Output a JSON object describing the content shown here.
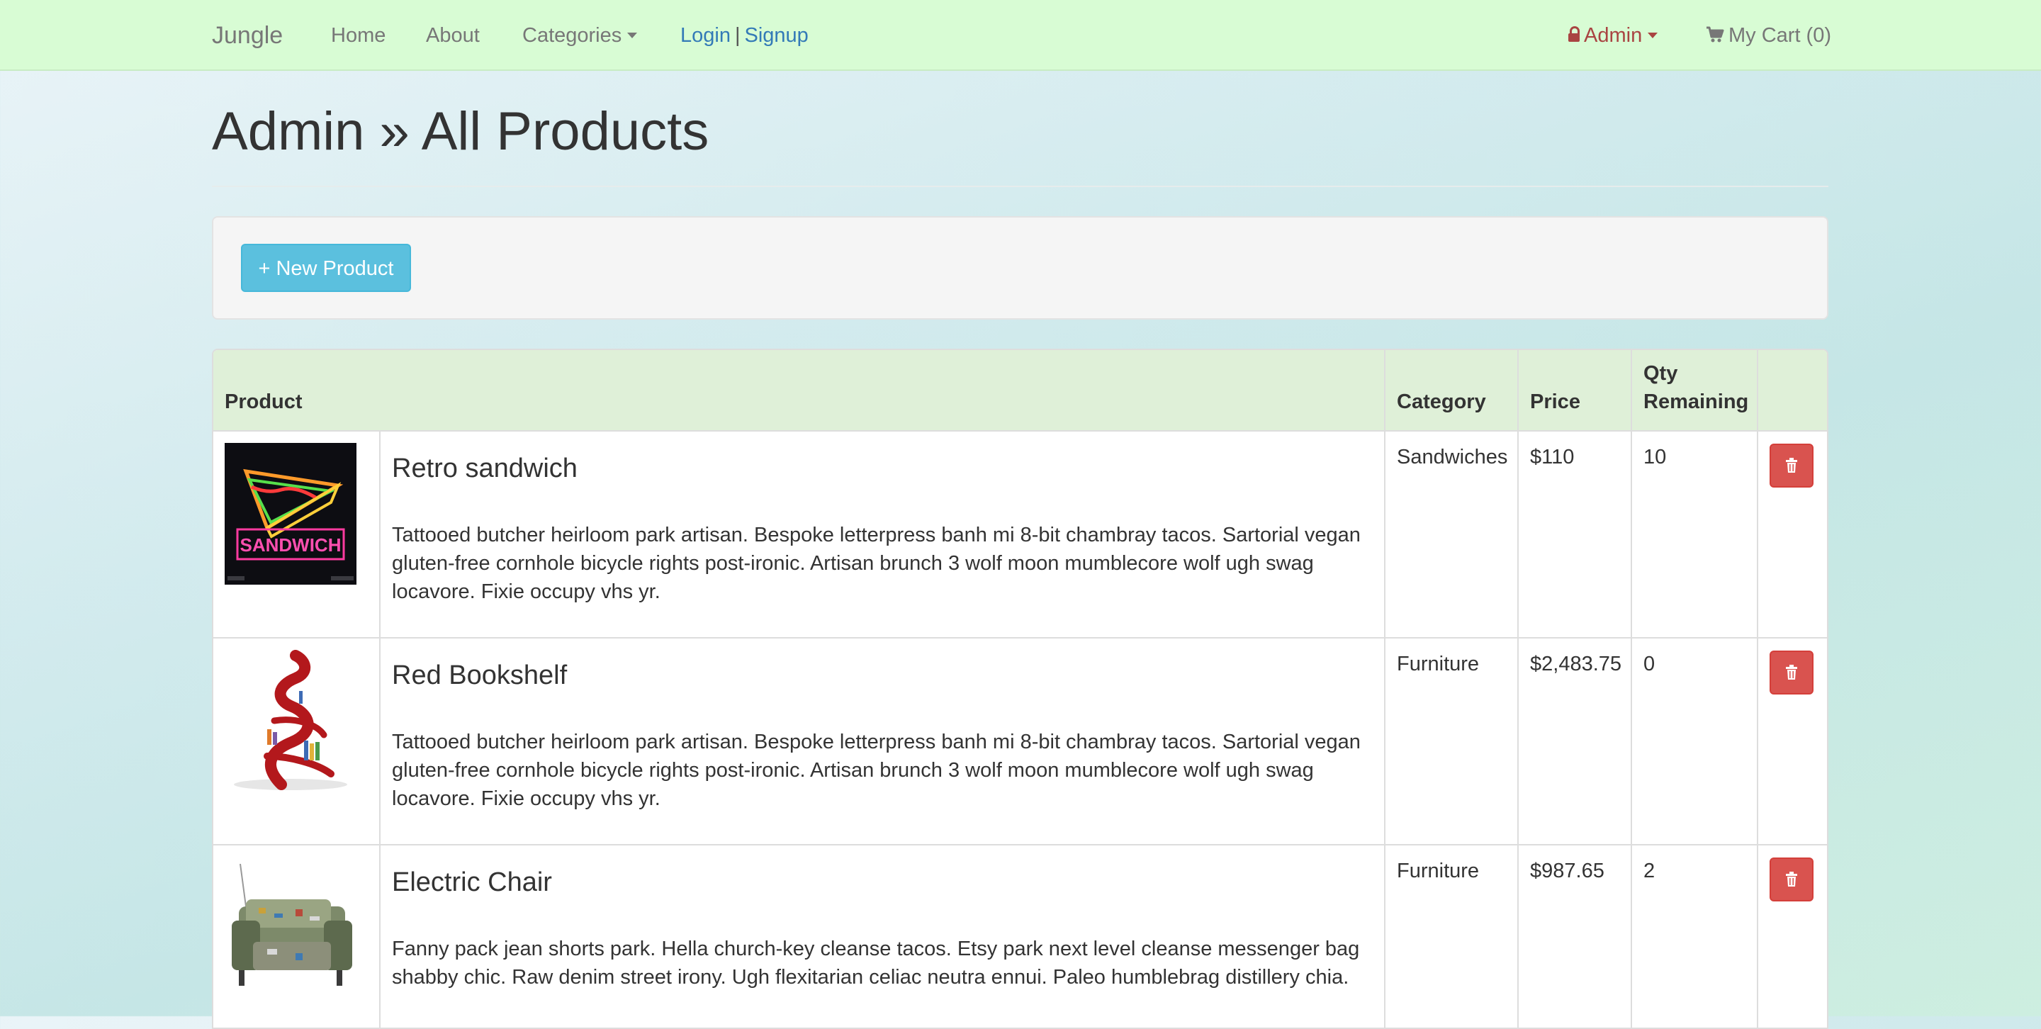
{
  "nav": {
    "brand": "Jungle",
    "home": "Home",
    "about": "About",
    "categories": "Categories",
    "login": "Login",
    "separator": "|",
    "signup": "Signup",
    "admin": "Admin",
    "cart": "My Cart (0)"
  },
  "page": {
    "title": "Admin » All Products",
    "new_product_label": "+ New Product"
  },
  "table": {
    "headers": {
      "product": "Product",
      "category": "Category",
      "price": "Price",
      "qty": "Qty Remaining"
    },
    "rows": [
      {
        "name": "Retro sandwich",
        "description": "Tattooed butcher heirloom park artisan. Bespoke letterpress banh mi 8-bit chambray tacos. Sartorial vegan gluten-free cornhole bicycle rights post-ironic. Artisan brunch 3 wolf moon mumblecore wolf ugh swag locavore. Fixie occupy vhs yr.",
        "category": "Sandwiches",
        "price": "$110",
        "qty": "10",
        "image_text": "SANDWICH"
      },
      {
        "name": "Red Bookshelf",
        "description": "Tattooed butcher heirloom park artisan. Bespoke letterpress banh mi 8-bit chambray tacos. Sartorial vegan gluten-free cornhole bicycle rights post-ironic. Artisan brunch 3 wolf moon mumblecore wolf ugh swag locavore. Fixie occupy vhs yr.",
        "category": "Furniture",
        "price": "$2,483.75",
        "qty": "0"
      },
      {
        "name": "Electric Chair",
        "description": "Fanny pack jean shorts park. Hella church-key cleanse tacos. Etsy park next level cleanse messenger bag shabby chic. Raw denim street irony. Ugh flexitarian celiac neutra ennui. Paleo humblebrag distillery chia.",
        "category": "Furniture",
        "price": "$987.65",
        "qty": "2"
      }
    ]
  },
  "colors": {
    "navbar_bg": "#d8fcd4",
    "link_blue": "#337ab7",
    "admin_red": "#a94442",
    "info_button": "#5bc0de",
    "danger_button": "#d9534f",
    "table_header_bg": "#dff0d8"
  },
  "icons": {
    "admin": "lock-icon",
    "cart": "shopping-cart-icon",
    "delete": "trash-icon",
    "dropdown": "caret-down-icon"
  }
}
